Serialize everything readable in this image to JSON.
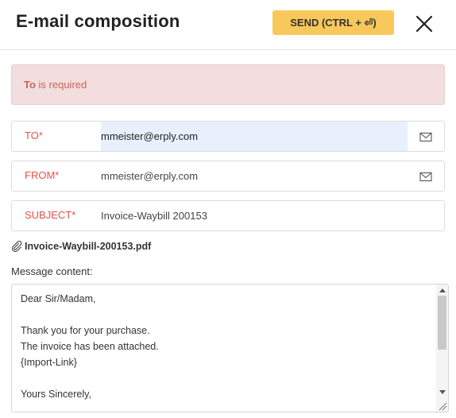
{
  "header": {
    "title": "E-mail composition",
    "send_label": "SEND (CTRL + ⏎)",
    "accent_color": "#f9c85a"
  },
  "alert": {
    "field": "To",
    "message": " is required",
    "color": "#c9635c"
  },
  "fields": {
    "to": {
      "label": "TO*",
      "value": "mmeister@erply.com"
    },
    "from": {
      "label": "FROM*",
      "value": "mmeister@erply.com"
    },
    "subject": {
      "label": "SUBJECT*",
      "value": "Invoice-Waybill 200153"
    }
  },
  "attachment": {
    "filename": "Invoice-Waybill-200153.pdf",
    "icon": "paperclip-icon"
  },
  "message": {
    "label": "Message content:",
    "lines": [
      "Dear Sir/Madam,",
      "",
      "Thank you for your purchase.",
      "The invoice has been attached.",
      "{Import-Link}",
      "",
      "Yours Sincerely,"
    ]
  }
}
